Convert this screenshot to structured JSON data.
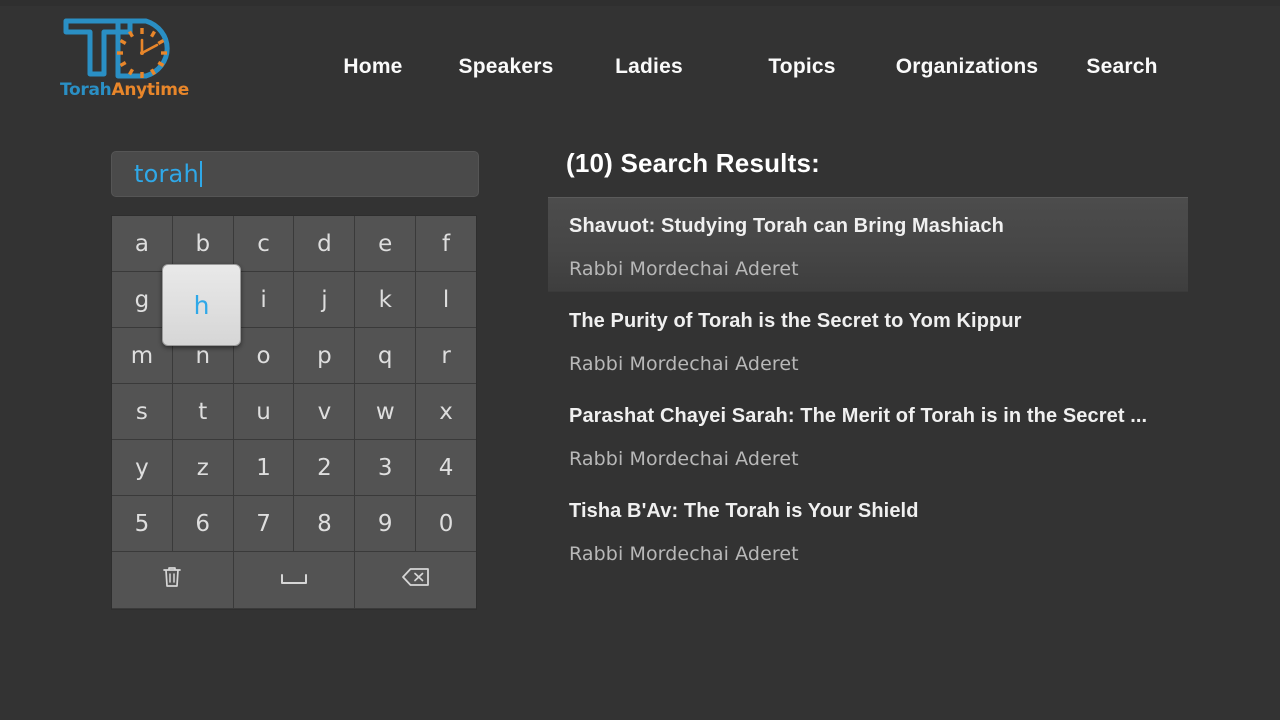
{
  "brand": {
    "logo_icon": "torahanytime-logo-icon",
    "wordmark_part1": "Torah",
    "wordmark_part2": "Anytime",
    "color_blue": "#2a8fc4",
    "color_orange": "#e8862a"
  },
  "nav": {
    "items": [
      {
        "label": "Home"
      },
      {
        "label": "Speakers"
      },
      {
        "label": "Ladies"
      },
      {
        "label": "Topics"
      },
      {
        "label": "Organizations"
      },
      {
        "label": "Search"
      }
    ]
  },
  "search": {
    "value": "torah",
    "placeholder": "",
    "text_color": "#2fa8e8"
  },
  "keyboard": {
    "focused_key": "h",
    "rows": [
      [
        "a",
        "b",
        "c",
        "d",
        "e",
        "f"
      ],
      [
        "g",
        "h",
        "i",
        "j",
        "k",
        "l"
      ],
      [
        "m",
        "n",
        "o",
        "p",
        "q",
        "r"
      ],
      [
        "s",
        "t",
        "u",
        "v",
        "w",
        "x"
      ],
      [
        "y",
        "z",
        "1",
        "2",
        "3",
        "4"
      ],
      [
        "5",
        "6",
        "7",
        "8",
        "9",
        "0"
      ]
    ],
    "action_row": [
      {
        "icon": "trash-icon",
        "label": ""
      },
      {
        "icon": "space-icon",
        "label": ""
      },
      {
        "icon": "backspace-icon",
        "label": ""
      }
    ]
  },
  "results": {
    "heading": "(10) Search Results:",
    "count": 10,
    "items": [
      {
        "title": "Shavuot: Studying Torah can Bring Mashiach",
        "speaker": "Rabbi Mordechai Aderet",
        "selected": true
      },
      {
        "title": "The Purity of Torah is the Secret to Yom Kippur",
        "speaker": "Rabbi Mordechai Aderet",
        "selected": false
      },
      {
        "title": "Parashat Chayei Sarah: The Merit of Torah is in the Secret ...",
        "speaker": "Rabbi Mordechai Aderet",
        "selected": false
      },
      {
        "title": "Tisha B'Av: The Torah is Your Shield",
        "speaker": "Rabbi Mordechai Aderet",
        "selected": false
      }
    ]
  }
}
